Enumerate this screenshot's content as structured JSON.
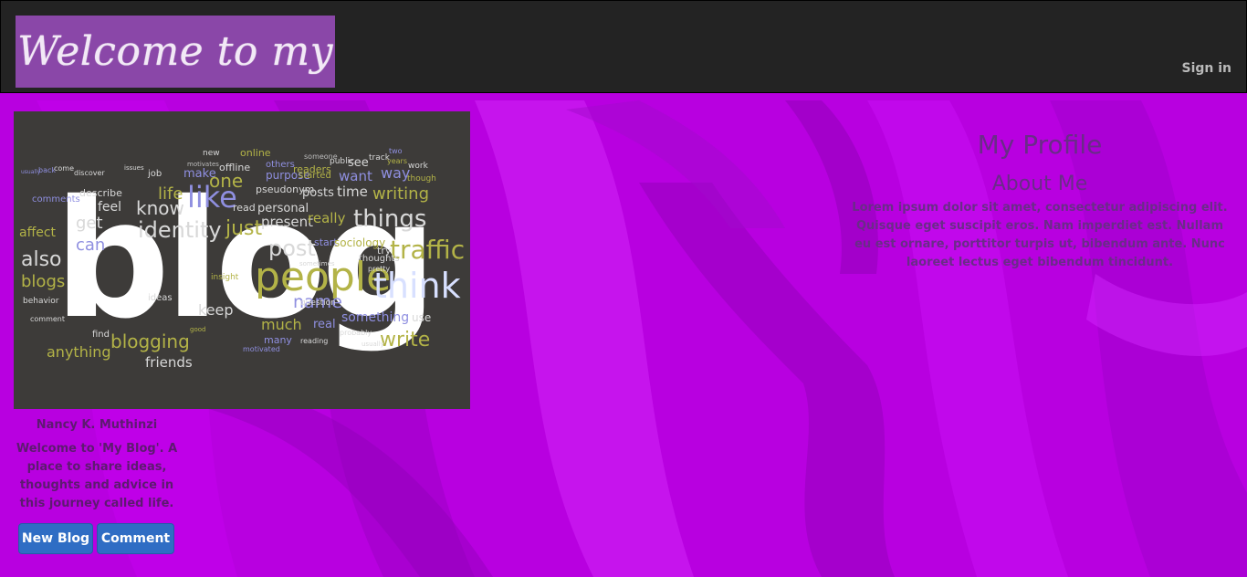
{
  "header": {
    "brand_text": "Welcome to my blog!",
    "signin_label": "Sign in"
  },
  "profile_image": {
    "main_word": "blog",
    "words": [
      {
        "t": "new",
        "c": "#d8d8d8"
      },
      {
        "t": "motivates",
        "c": "#bdbdbd"
      },
      {
        "t": "online",
        "c": "#b3b347"
      },
      {
        "t": "others",
        "c": "#8f8fe0"
      },
      {
        "t": "someone",
        "c": "#bdbdbd"
      },
      {
        "t": "readers",
        "c": "#b3b347"
      },
      {
        "t": "public",
        "c": "#d8d8d8"
      },
      {
        "t": "see",
        "c": "#d8d8d8"
      },
      {
        "t": "track",
        "c": "#d8d8d8"
      },
      {
        "t": "two",
        "c": "#8f8fe0"
      },
      {
        "t": "years",
        "c": "#b3b347"
      },
      {
        "t": "work",
        "c": "#d8d8d8"
      },
      {
        "t": "usually",
        "c": "#8f8fe0"
      },
      {
        "t": "back",
        "c": "#8f8fe0"
      },
      {
        "t": "come",
        "c": "#d8d8d8"
      },
      {
        "t": "discover",
        "c": "#d8d8d8"
      },
      {
        "t": "issues",
        "c": "#d8d8d8"
      },
      {
        "t": "job",
        "c": "#d8d8d8"
      },
      {
        "t": "make",
        "c": "#8f8fe0"
      },
      {
        "t": "offline",
        "c": "#d8d8d8"
      },
      {
        "t": "purpose",
        "c": "#8f8fe0"
      },
      {
        "t": "started",
        "c": "#b3b347"
      },
      {
        "t": "want",
        "c": "#8f8fe0"
      },
      {
        "t": "way",
        "c": "#8f8fe0"
      },
      {
        "t": "though",
        "c": "#b3b347"
      },
      {
        "t": "one",
        "c": "#b3b347"
      },
      {
        "t": "like",
        "c": "#8f8fe0"
      },
      {
        "t": "life",
        "c": "#b3b347"
      },
      {
        "t": "describe",
        "c": "#d8d8d8"
      },
      {
        "t": "comments",
        "c": "#8f8fe0"
      },
      {
        "t": "pseudonym",
        "c": "#d8d8d8"
      },
      {
        "t": "posts",
        "c": "#d8d8d8"
      },
      {
        "t": "time",
        "c": "#d8d8d8"
      },
      {
        "t": "writing",
        "c": "#b3b347"
      },
      {
        "t": "feel",
        "c": "#d8d8d8"
      },
      {
        "t": "know",
        "c": "#d8d8d8"
      },
      {
        "t": "read",
        "c": "#d8d8d8"
      },
      {
        "t": "personal",
        "c": "#d8d8d8"
      },
      {
        "t": "present",
        "c": "#d8d8d8"
      },
      {
        "t": "really",
        "c": "#b3b347"
      },
      {
        "t": "things",
        "c": "#d8d8d8"
      },
      {
        "t": "get",
        "c": "#d8d8d8"
      },
      {
        "t": "identity",
        "c": "#d8d8d8"
      },
      {
        "t": "just",
        "c": "#b3b347"
      },
      {
        "t": "affect",
        "c": "#b3b347"
      },
      {
        "t": "can",
        "c": "#8f8fe0"
      },
      {
        "t": "start",
        "c": "#8f8fe0"
      },
      {
        "t": "sociology",
        "c": "#b3b347"
      },
      {
        "t": "traffic",
        "c": "#b3b347"
      },
      {
        "t": "also",
        "c": "#d8d8d8"
      },
      {
        "t": "post",
        "c": "#d8d8d8"
      },
      {
        "t": "try",
        "c": "#d8d8d8"
      },
      {
        "t": "thoughts",
        "c": "#d8d8d8"
      },
      {
        "t": "people",
        "c": "#b3b347"
      },
      {
        "t": "think",
        "c": "#d8e0ff"
      },
      {
        "t": "blogs",
        "c": "#b3b347"
      },
      {
        "t": "sometimes",
        "c": "#d8d8d8"
      },
      {
        "t": "pretty",
        "c": "#d8d8d8"
      },
      {
        "t": "insight",
        "c": "#b3b347"
      },
      {
        "t": "name",
        "c": "#8f8fe0"
      },
      {
        "t": "ideas",
        "c": "#d8d8d8"
      },
      {
        "t": "keep",
        "c": "#d8d8d8"
      },
      {
        "t": "question",
        "c": "#d8d8d8"
      },
      {
        "t": "behavior",
        "c": "#d8d8d8"
      },
      {
        "t": "comment",
        "c": "#d8d8d8"
      },
      {
        "t": "much",
        "c": "#b3b347"
      },
      {
        "t": "real",
        "c": "#8f8fe0"
      },
      {
        "t": "something",
        "c": "#8f8fe0"
      },
      {
        "t": "use",
        "c": "#d8d8d8"
      },
      {
        "t": "find",
        "c": "#d8d8d8"
      },
      {
        "t": "many",
        "c": "#8f8fe0"
      },
      {
        "t": "probably",
        "c": "#d8d8d8"
      },
      {
        "t": "write",
        "c": "#b3b347"
      },
      {
        "t": "anything",
        "c": "#b3b347"
      },
      {
        "t": "blogging",
        "c": "#b3b347"
      },
      {
        "t": "friends",
        "c": "#d8d8d8"
      },
      {
        "t": "good",
        "c": "#b3b347"
      },
      {
        "t": "reading",
        "c": "#d8d8d8"
      },
      {
        "t": "motivated",
        "c": "#8f8fe0"
      },
      {
        "t": "usually",
        "c": "#d8d8d8"
      }
    ]
  },
  "profile": {
    "author_name": "Nancy K. Muthinzi",
    "bio": "Welcome to 'My Blog'. A place to share ideas, thoughts and advice in this journey called life."
  },
  "buttons": {
    "new_blog": "New Blog",
    "comment": "Comment"
  },
  "right_panel": {
    "title": "My Profile",
    "subtitle": "About Me",
    "body": "Lorem ipsum dolor sit amet, consectetur adipiscing elit. Quisque eget suscipit eros. Nam imperdiet est. Nullam eu est ornare, porttitor turpis ut, bibendum ante. Nunc laoreet lectus eget bibendum tincidunt."
  },
  "colors": {
    "background": "#b800e0",
    "navbar": "#232323",
    "brand_bg": "#8a47a8",
    "button": "#2f6dc4",
    "profile_text": "#5d1a70"
  }
}
